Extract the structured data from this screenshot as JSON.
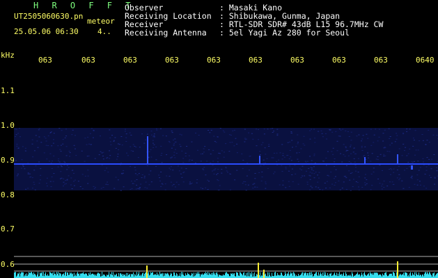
{
  "header": {
    "app_title": "H R O F F T",
    "file_name": "UT2505060630.pn",
    "mode": "meteor",
    "date_time": "25.05.06 06:30",
    "count": "4.."
  },
  "meta": [
    {
      "label": "Observer",
      "value": ": Masaki Kano"
    },
    {
      "label": "Receiving Location",
      "value": ": Shibukawa, Gunma, Japan"
    },
    {
      "label": "Receiver",
      "value": ": RTL-SDR SDR# 43dB L15 96.7MHz CW"
    },
    {
      "label": "Receiving Antenna",
      "value": ": 5el Yagi Az 280 for Seoul"
    }
  ],
  "axis": {
    "unit": "kHz",
    "time_ticks": [
      "063",
      "063",
      "063",
      "063",
      "063",
      "063",
      "063",
      "063",
      "063",
      "0640"
    ],
    "freq_ticks": [
      "1.1",
      "1.0",
      "0.9",
      "0.8",
      "0.7",
      "0.6"
    ]
  },
  "colors": {
    "background": "#000000",
    "text_yellow": "#ffff66",
    "title_green": "#7fff7f",
    "signal_blue": "#2244ff",
    "noise_blue": "#101a55",
    "trace_cyan": "#33ddee"
  }
}
